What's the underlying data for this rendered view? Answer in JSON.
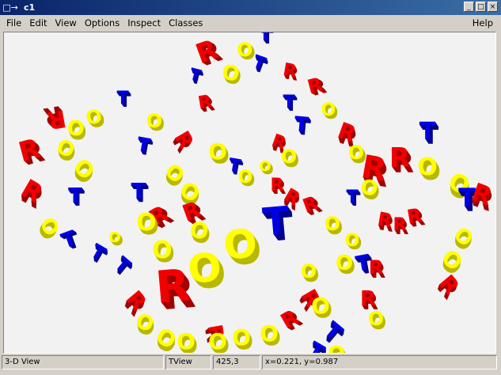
{
  "window": {
    "title": "c1",
    "menu_icon": "□→",
    "buttons": {
      "minimize": "_",
      "maximize": "□",
      "close": "×"
    }
  },
  "menu": {
    "file": "File",
    "edit": "Edit",
    "view": "View",
    "options": "Options",
    "inspect": "Inspect",
    "classes": "Classes",
    "help": "Help"
  },
  "status": {
    "view_name": "3-D View",
    "object": "TView",
    "pixel_coords": "425,3",
    "world_coords": "x=0.221, y=0.987"
  },
  "colors": {
    "red": "#f00000",
    "red_dark": "#a00000",
    "yellow": "#ffff00",
    "yellow_dark": "#b8b800",
    "blue": "#0000e6",
    "blue_dark": "#00008c"
  }
}
